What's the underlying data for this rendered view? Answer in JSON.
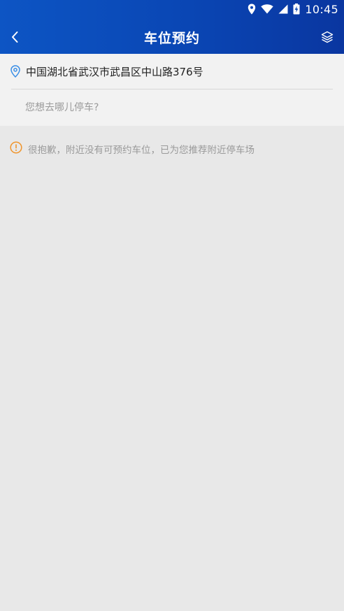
{
  "status_bar": {
    "time": "10:45",
    "icons": [
      "location-icon",
      "wifi-icon",
      "cellular-signal-icon",
      "battery-charging-icon"
    ]
  },
  "header": {
    "title": "车位预约",
    "back_icon": "chevron-left-icon",
    "layers_icon": "layers-icon"
  },
  "search": {
    "current_location": "中国湖北省武汉市武昌区中山路376号",
    "destination_value": "",
    "destination_placeholder": "您想去哪儿停车?"
  },
  "notice": {
    "text": "很抱歉，附近没有可预约车位，已为您推荐附近停车场"
  },
  "colors": {
    "header_start": "#0d55c4",
    "header_end": "#0a36a0",
    "location_pin": "#3a8ee6",
    "warning": "#f0942a",
    "map_background": "#e8e8e8",
    "panel_background": "#f2f2f2"
  }
}
